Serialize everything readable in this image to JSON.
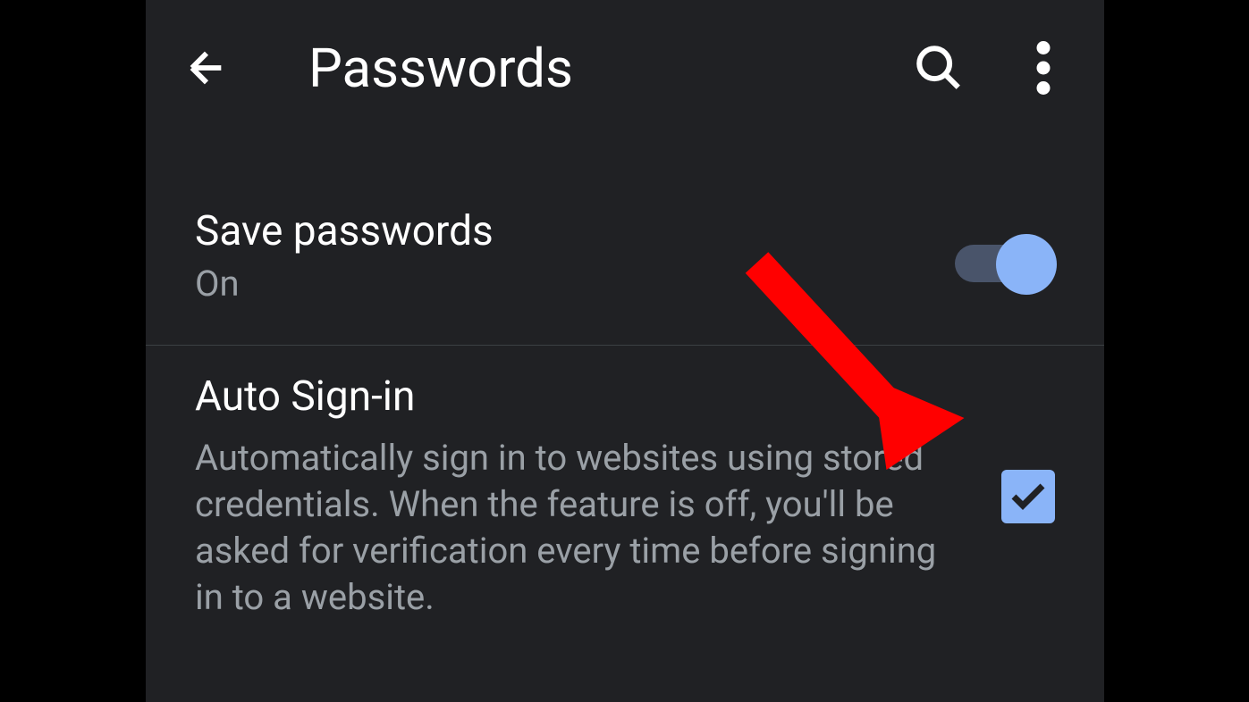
{
  "header": {
    "title": "Passwords"
  },
  "settings": {
    "save_passwords": {
      "title": "Save passwords",
      "status": "On"
    },
    "auto_sign_in": {
      "title": "Auto Sign-in",
      "description": "Automatically sign in to websites using stored credentials. When the feature is off, you'll be asked for verification every time before signing in to a website."
    }
  }
}
